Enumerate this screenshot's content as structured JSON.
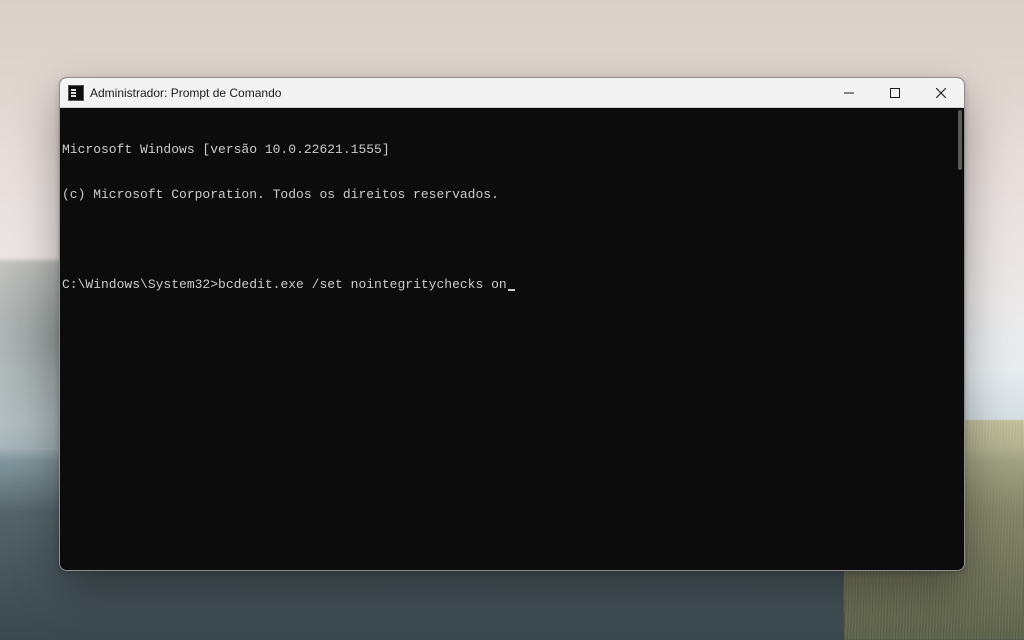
{
  "window": {
    "title": "Administrador: Prompt de Comando"
  },
  "terminal": {
    "header_line1": "Microsoft Windows [versão 10.0.22621.1555]",
    "header_line2": "(c) Microsoft Corporation. Todos os direitos reservados.",
    "prompt_path": "C:\\Windows\\System32>",
    "typed_command": "bcdedit.exe /set nointegritychecks on"
  },
  "controls": {
    "minimize": "minimize",
    "maximize": "maximize",
    "close": "close"
  }
}
